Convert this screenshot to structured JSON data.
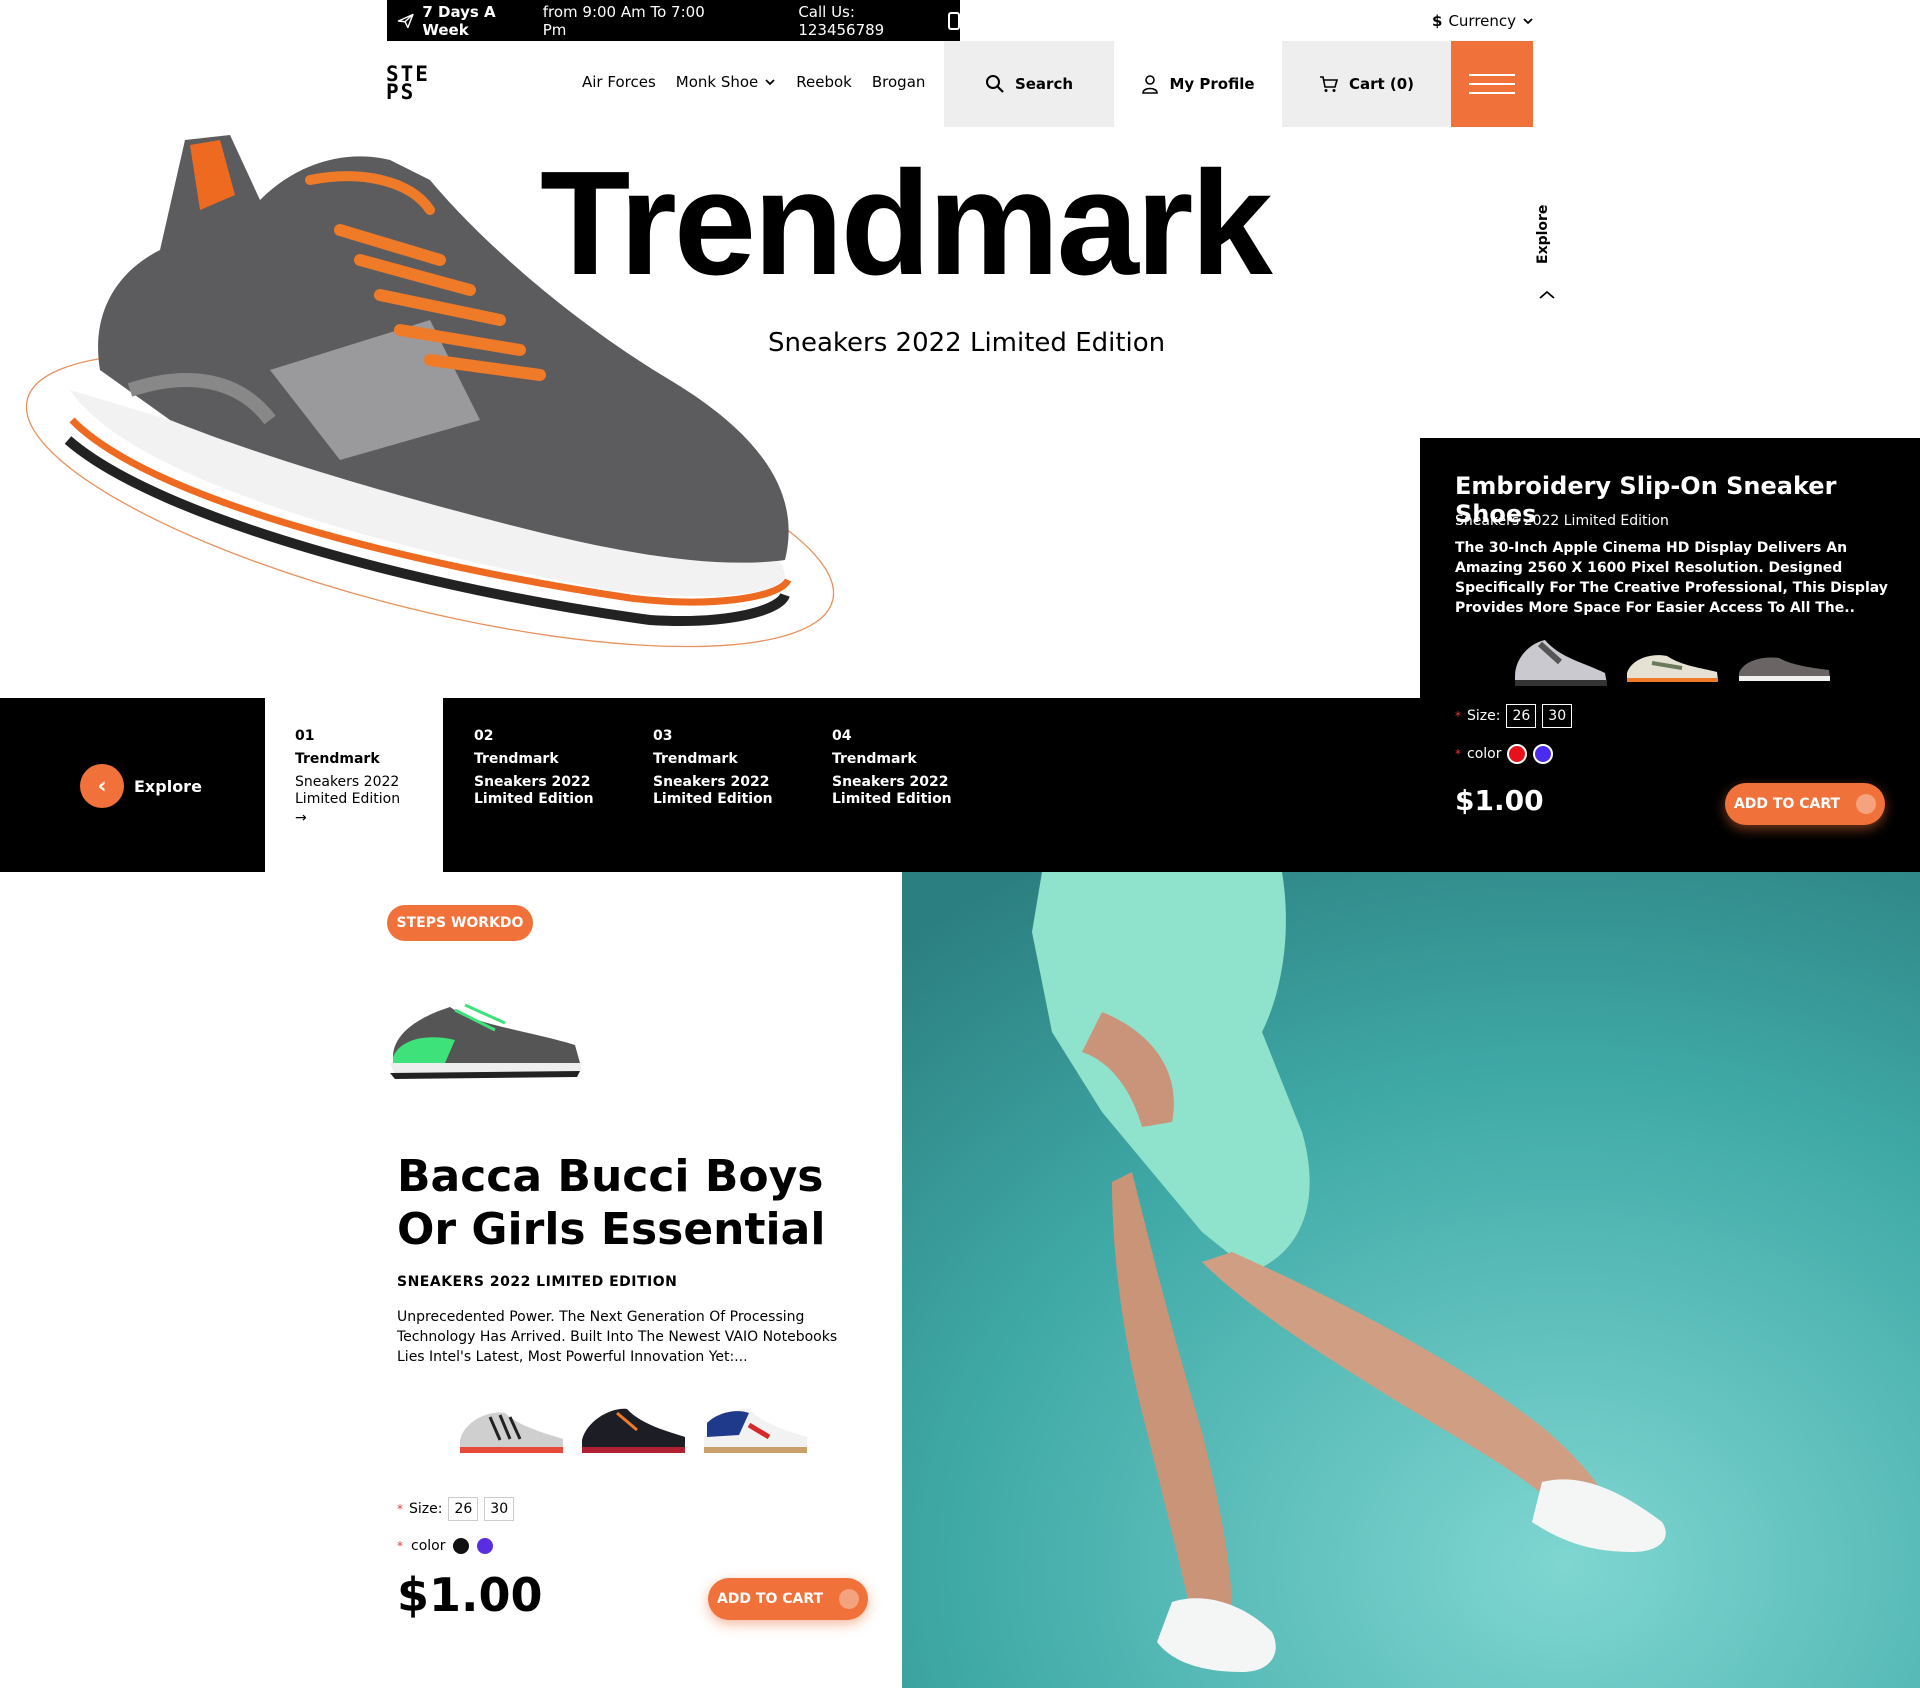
{
  "topbar": {
    "days": "7 Days A Week",
    "hours": "from 9:00 Am To 7:00 Pm",
    "call": "Call Us: 123456789"
  },
  "currency": {
    "symbol": "$",
    "label": "Currency"
  },
  "logo": {
    "line1": "STE",
    "line2": "PS"
  },
  "nav": [
    {
      "label": "Air Forces"
    },
    {
      "label": "Monk Shoe"
    },
    {
      "label": "Reebok"
    },
    {
      "label": "Brogan"
    }
  ],
  "header": {
    "search_label": "Search",
    "profile_label": "My Profile",
    "cart_label": "Cart (0)"
  },
  "hero": {
    "title": "Trendmark",
    "subtitle": "Sneakers 2022 Limited Edition",
    "explore_vertical": "Explore"
  },
  "strip": {
    "explore_label": "Explore",
    "slides": [
      {
        "num": "01",
        "title": "Trendmark",
        "text": "Sneakers 2022 Limited Edition"
      },
      {
        "num": "02",
        "title": "Trendmark",
        "text": "Sneakers 2022 Limited Edition"
      },
      {
        "num": "03",
        "title": "Trendmark",
        "text": "Sneakers 2022 Limited Edition"
      },
      {
        "num": "04",
        "title": "Trendmark",
        "text": "Sneakers 2022 Limited Edition"
      }
    ]
  },
  "panel": {
    "title": "Embroidery Slip-On Sneaker Shoes",
    "subtitle": "Sneakers 2022 Limited Edition",
    "description": "The 30-Inch Apple Cinema HD Display Delivers An Amazing 2560 X 1600 Pixel Resolution. Designed Specifically For The Creative Professional, This Display Provides More Space For Easier Access To All The..",
    "size_label": "Size:",
    "sizes": [
      "26",
      "30"
    ],
    "color_label": "color",
    "colors": [
      "#e8101a",
      "#4a2bf0"
    ],
    "price": "$1.00",
    "cart_button": "ADD TO CART"
  },
  "product": {
    "badge": "STEPS WORKDO",
    "title": "Bacca Bucci Boys Or Girls Essential",
    "subtitle": "SNEAKERS 2022 LIMITED EDITION",
    "description": "Unprecedented Power. The Next Generation Of Processing Technology Has Arrived. Built Into The Newest VAIO Notebooks Lies Intel's Latest, Most Powerful Innovation Yet:...",
    "size_label": "Size:",
    "sizes": [
      "26",
      "30"
    ],
    "color_label": "color",
    "colors": [
      "#111111",
      "#5a2ee0"
    ],
    "price": "$1.00",
    "cart_button": "ADD TO CART"
  },
  "theme": {
    "accent": "#f0713a",
    "dark": "#000000",
    "teal": "#5fc4c0"
  }
}
